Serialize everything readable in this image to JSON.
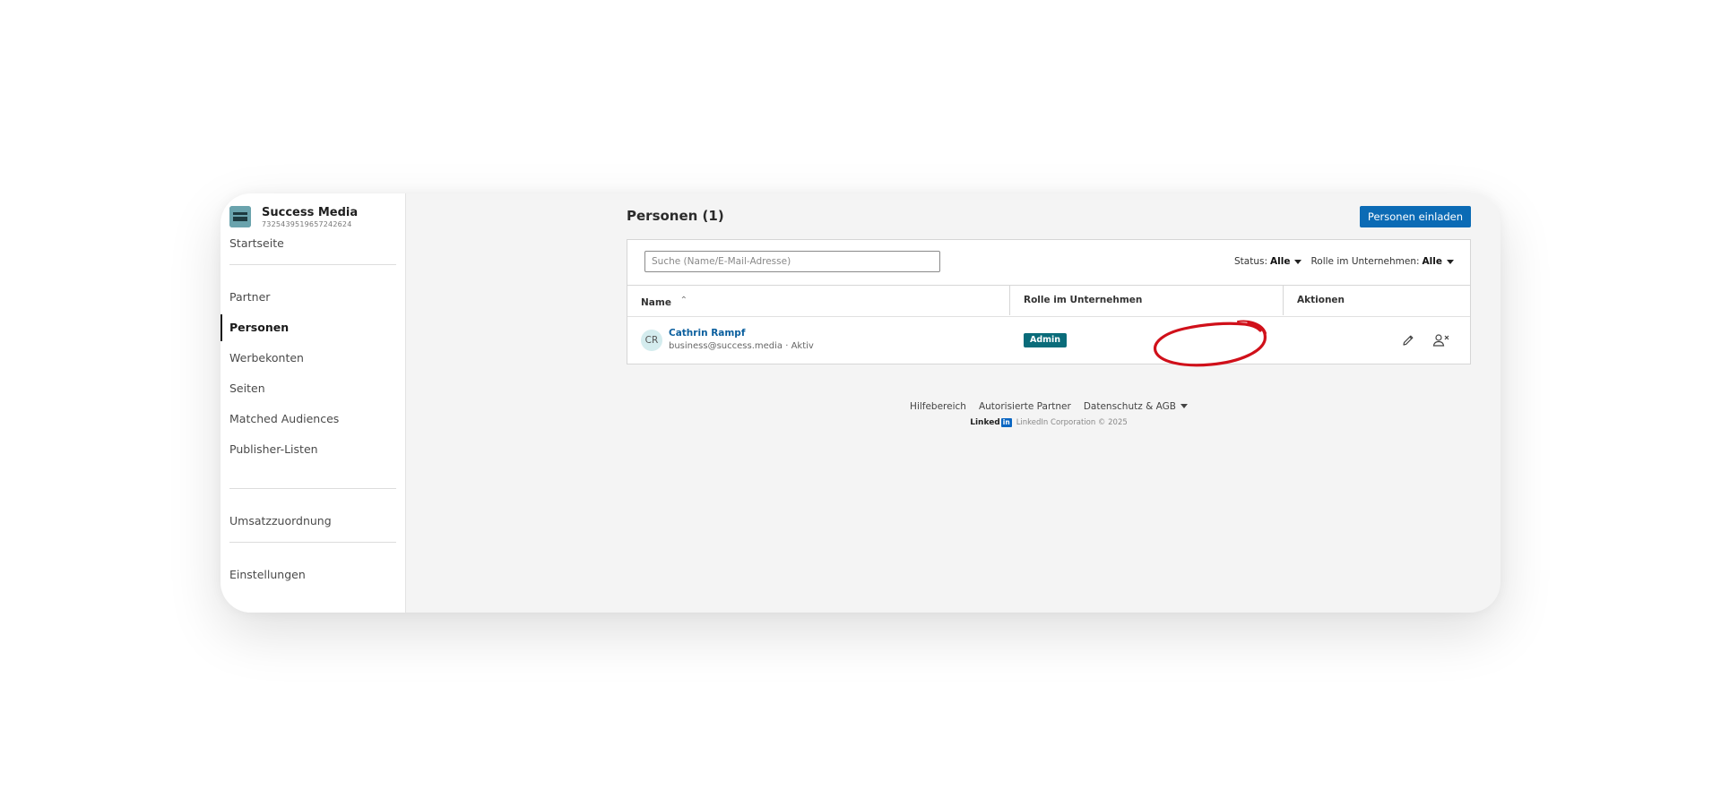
{
  "org": {
    "logo_text": "Success Media",
    "name": "Success Media",
    "id": "73254395196572426​24"
  },
  "sidebar": {
    "items": [
      {
        "label": "Startseite"
      },
      {
        "label": "Partner"
      },
      {
        "label": "Personen",
        "active": true
      },
      {
        "label": "Werbekonten"
      },
      {
        "label": "Seiten"
      },
      {
        "label": "Matched Audiences"
      },
      {
        "label": "Publisher-Listen"
      },
      {
        "label": "Umsatzzuordnung"
      },
      {
        "label": "Einstellungen"
      }
    ]
  },
  "header": {
    "title": "Personen (1)",
    "invite_label": "Personen einladen"
  },
  "search": {
    "placeholder": "Suche (Name/E-Mail-Adresse)",
    "value": ""
  },
  "filters": {
    "status_label": "Status:",
    "status_value": "Alle",
    "role_label": "Rolle im Unternehmen:",
    "role_value": "Alle"
  },
  "table": {
    "columns": [
      "Name",
      "Rolle im Unternehmen",
      "Aktionen"
    ],
    "rows": [
      {
        "initials": "CR",
        "name": "Cathrin Rampf",
        "subtitle": "business@success.media · Aktiv",
        "role": "Admin"
      }
    ]
  },
  "footer": {
    "links": [
      "Hilfebereich",
      "Autorisierte Partner",
      "Datenschutz & AGB"
    ],
    "logo_text": "Linked",
    "logo_in": "in",
    "copyright": "LinkedIn Corporation © 2025"
  },
  "colors": {
    "primary": "#0b6bb5",
    "badge": "#0a6c7a",
    "highlight": "#d0101a"
  }
}
